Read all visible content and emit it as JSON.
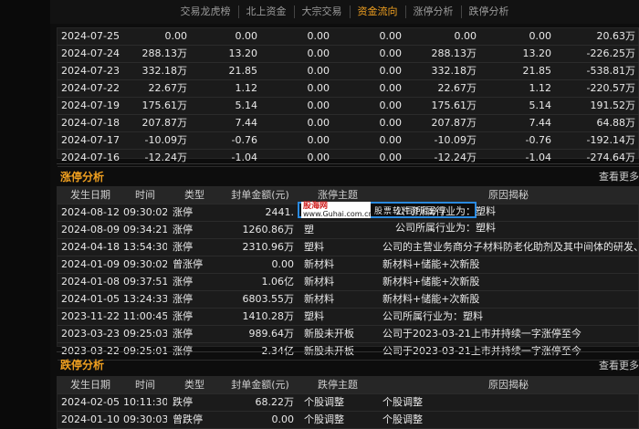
{
  "tabs": [
    {
      "label": "交易龙虎榜",
      "active": false
    },
    {
      "label": "北上资金",
      "active": false
    },
    {
      "label": "大宗交易",
      "active": false
    },
    {
      "label": "资金流向",
      "active": true
    },
    {
      "label": "涨停分析",
      "active": false
    },
    {
      "label": "跌停分析",
      "active": false
    }
  ],
  "flow_rows": [
    [
      "2024-07-25",
      "0.00",
      "0.00",
      "0.00",
      "0.00",
      "0.00",
      "0.00",
      "20.63万"
    ],
    [
      "2024-07-24",
      "288.13万",
      "13.20",
      "0.00",
      "0.00",
      "288.13万",
      "13.20",
      "-226.25万"
    ],
    [
      "2024-07-23",
      "332.18万",
      "21.85",
      "0.00",
      "0.00",
      "332.18万",
      "21.85",
      "-538.81万"
    ],
    [
      "2024-07-22",
      "22.67万",
      "1.12",
      "0.00",
      "0.00",
      "22.67万",
      "1.12",
      "-220.57万"
    ],
    [
      "2024-07-19",
      "175.61万",
      "5.14",
      "0.00",
      "0.00",
      "175.61万",
      "5.14",
      "191.52万"
    ],
    [
      "2024-07-18",
      "207.87万",
      "7.44",
      "0.00",
      "0.00",
      "207.87万",
      "7.44",
      "64.88万"
    ],
    [
      "2024-07-17",
      "-10.09万",
      "-0.76",
      "0.00",
      "0.00",
      "-10.09万",
      "-0.76",
      "-192.14万"
    ],
    [
      "2024-07-16",
      "-12.24万",
      "-1.04",
      "0.00",
      "0.00",
      "-12.24万",
      "-1.04",
      "-274.64万"
    ]
  ],
  "limit_up": {
    "title": "涨停分析",
    "more": "查看更多",
    "headers": [
      "发生日期",
      "时间",
      "类型",
      "封单金额(元)",
      "涨停主题",
      "原因揭秘"
    ],
    "rows": [
      [
        "2024-08-12",
        "09:30:02",
        "涨停",
        "2441.",
        "",
        ""
      ],
      [
        "2024-08-09",
        "09:34:21",
        "涨停",
        "1260.86万",
        "塑",
        ""
      ],
      [
        "2024-04-18",
        "13:54:30",
        "涨停",
        "2310.96万",
        "塑料",
        "公司的主营业务商分子材料防老化助剂及其中间体的研发、生产、"
      ],
      [
        "2024-01-09",
        "09:30:02",
        "曾涨停",
        "0.00",
        "新材料",
        "新材料+储能+次新股"
      ],
      [
        "2024-01-08",
        "09:37:51",
        "涨停",
        "1.06亿",
        "新材料",
        "新材料+储能+次新股"
      ],
      [
        "2024-01-05",
        "13:24:33",
        "涨停",
        "6803.55万",
        "新材料",
        "新材料+储能+次新股"
      ],
      [
        "2023-11-22",
        "11:00:45",
        "涨停",
        "1410.28万",
        "塑料",
        "公司所属行业为：塑料"
      ],
      [
        "2023-03-23",
        "09:25:03",
        "涨停",
        "989.64万",
        "新股未开板",
        "公司于2023-03-21上市并持续一字涨停至今"
      ],
      [
        "2023-03-22",
        "09:25:01",
        "涨停",
        "2.34亿",
        "新股未开板",
        "公司于2023-03-21上市并持续一字涨停至今"
      ]
    ]
  },
  "limit_down": {
    "title": "跌停分析",
    "more": "查看更多",
    "headers": [
      "发生日期",
      "时间",
      "类型",
      "封单金额(元)",
      "跌停主题",
      "原因揭秘"
    ],
    "rows": [
      [
        "2024-02-05",
        "10:11:30",
        "跌停",
        "68.22万",
        "个股调整",
        "个股调整"
      ],
      [
        "2024-01-10",
        "09:30:03",
        "曾跌停",
        "0.00",
        "个股调整",
        "个股调整"
      ]
    ]
  },
  "watermark": {
    "logo": "股海网",
    "url": "www.Guhai.com.cn",
    "slogan": "股票软件资源分享",
    "row1_reason": "公司所属行业为：塑料",
    "row2_reason": "公司所属行业为：塑料"
  }
}
